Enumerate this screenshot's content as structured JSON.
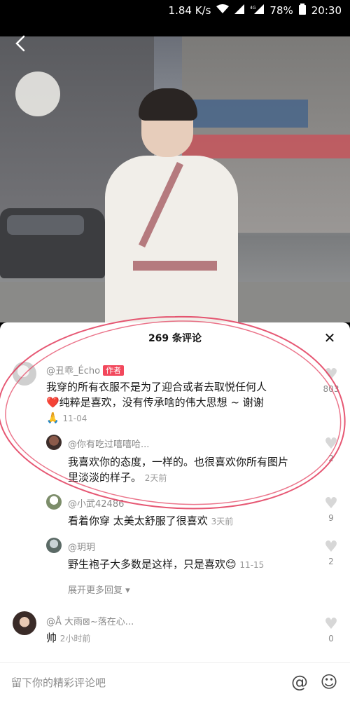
{
  "status_bar": {
    "speed": "1.84 K/s",
    "battery": "78%",
    "time": "20:30",
    "icons": [
      "wifi-icon",
      "signal-icon",
      "4g-signal-icon",
      "battery-icon"
    ]
  },
  "comments_panel": {
    "title": "269 条评论",
    "comments": [
      {
        "user": "@丑乖_Écho",
        "badge": "作者",
        "text1": "我穿的所有衣服不是为了迎合或者去取悦任何人",
        "text2": "❤️纯粹是喜欢，没有传承啥的伟大思想 ~ 谢谢",
        "text3": "🙏",
        "time": "11-04",
        "likes": "803"
      },
      {
        "user": "@你有吃过嘻嘻哈...",
        "text1": "我喜欢你的态度，一样的。也很喜欢你所有图片",
        "text2": "里淡淡的样子。",
        "time": "2天前",
        "likes": "2"
      },
      {
        "user": "@小武42486",
        "text": "看着你穿 太美太舒服了很喜欢",
        "time": "3天前",
        "likes": "9"
      },
      {
        "user": "@玥玥",
        "text": "野生袍子大多数是这样，只是喜欢😊",
        "time": "11-15",
        "likes": "2"
      },
      {
        "user": "@Å  大雨⊠~落在心...",
        "text": "帅",
        "time": "2小时前",
        "likes": "0"
      }
    ],
    "expand_label": "展开更多回复",
    "input_placeholder": "留下你的精彩评论吧",
    "at_icon": "@",
    "emoji_icon": "☺"
  },
  "colors": {
    "badge": "#f2485c",
    "annotation": "#e23a5a"
  }
}
